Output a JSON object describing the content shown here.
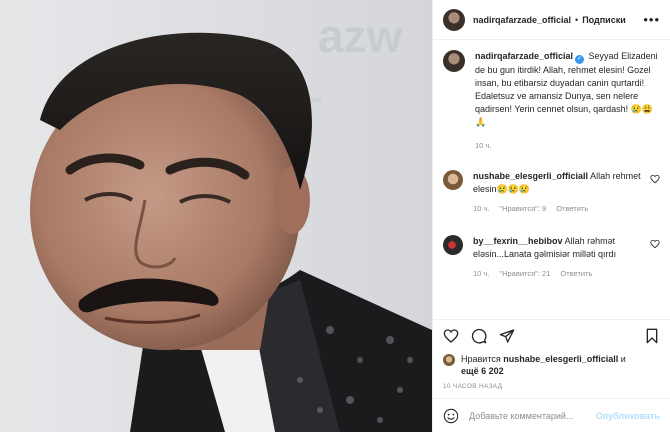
{
  "post": {
    "username": "nadirqafarzade_official",
    "follow_label": "Подписки",
    "separator": "•",
    "more_icon": "more-horizontal-icon"
  },
  "caption": {
    "username": "nadirqafarzade_official",
    "text": "Seyyad Elizadeni de bu gun itirdik! Allah, rehmet elesin! Gozel insan, bu etibarsiz duyadan canin qurtardi! Edaletsuz ve amansiz Dunya, sen nelere qadirsen! Yerin cennet olsun, qardash! 😢😩🙏",
    "time": "10 ч."
  },
  "comments": [
    {
      "username": "nushabe_elesgerli_officiall",
      "text": "Allah rehmet elesin😢😢😢",
      "time": "10 ч.",
      "likes": "\"Нравится\": 9",
      "reply": "Ответить"
    },
    {
      "username": "by__fexrin__hebibov",
      "text": "Allah rəhmət eləsin...Lanata gəlmisiər milləti qırdı",
      "time": "10 ч.",
      "likes": "\"Нравится\": 21",
      "reply": "Ответить"
    }
  ],
  "likes_line": {
    "prefix": "Нравится",
    "user": "nushabe_elesgerli_officiall",
    "suffix": "и",
    "more": "ещё 6 202"
  },
  "timestamp": "10 ЧАСОВ НАЗАД",
  "composer": {
    "placeholder": "Добавьте комментарий...",
    "publish": "Опубликовать"
  },
  "photo": {
    "watermark": "azw"
  },
  "colors": {
    "link": "#3897f0",
    "publish_disabled": "#b2dffc",
    "meta": "#8e8e8e"
  }
}
